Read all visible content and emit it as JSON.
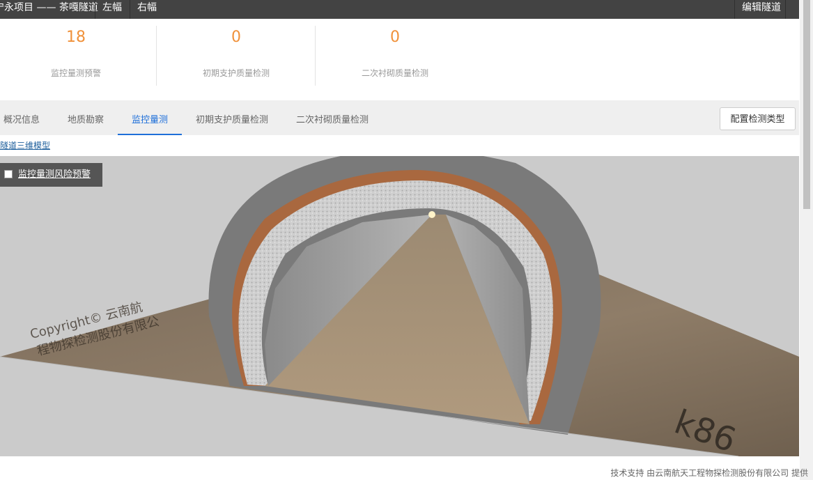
{
  "topbar": {
    "project_title": "宁永项目 —— 茶嘎隧道",
    "left_label": "左幅",
    "right_label": "右幅",
    "edit_label": "编辑隧道"
  },
  "stats": [
    {
      "value": "18",
      "label": "监控量测预警"
    },
    {
      "value": "0",
      "label": "初期支护质量检测"
    },
    {
      "value": "0",
      "label": "二次衬砌质量检测"
    }
  ],
  "tabs": [
    {
      "label": "概况信息"
    },
    {
      "label": "地质勘察"
    },
    {
      "label": "监控量测"
    },
    {
      "label": "初期支护质量检测"
    },
    {
      "label": "二次衬砌质量检测"
    }
  ],
  "active_tab": "监控量测",
  "config_button": "配置检测类型",
  "model_link": "隧道三维模型",
  "viewport": {
    "risk_toggle_label": "监控量测风险预警",
    "risk_toggle_checked": false,
    "ground_text": [
      "Copyright© 云南航",
      "程物探检测股份有限公"
    ],
    "station_label": "k86"
  },
  "footer": "技术支持 由云南航天工程物探检测股份有限公司 提供",
  "colors": {
    "accent": "#1e6fd9",
    "stat_number": "#f0913a",
    "topbar": "#434343"
  }
}
